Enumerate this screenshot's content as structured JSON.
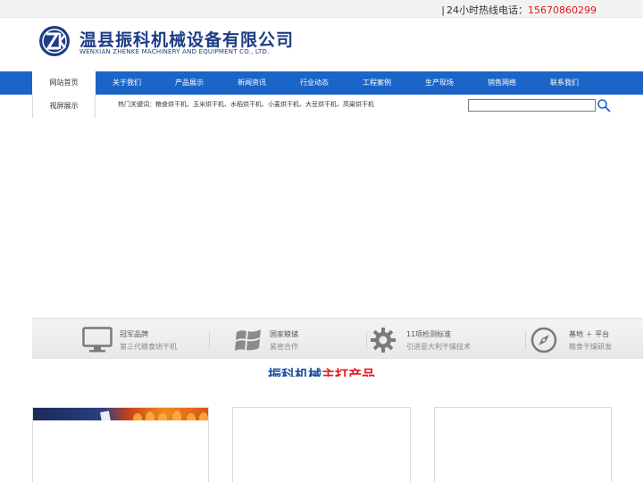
{
  "topbar": {
    "separator": "|",
    "hotline_label": "24小时热线电话：",
    "hotline_phone": "15670860299",
    "colors": {
      "phone": "#e0191f"
    }
  },
  "header": {
    "company_name": "温县振科机械设备有限公司",
    "company_name_en": "WENXIAN ZHENKE MACHINERY AND EQUIPMENT CO., LTD.",
    "logo_icon": "zk-logo-icon",
    "brand_color": "#1d3d86"
  },
  "nav": {
    "color": "#1b64c8",
    "items": [
      {
        "label": "网站首页",
        "active": true
      },
      {
        "label": "关于我们"
      },
      {
        "label": "产品展示"
      },
      {
        "label": "新闻资讯"
      },
      {
        "label": "行业动态"
      },
      {
        "label": "工程案例"
      },
      {
        "label": "生产现场"
      },
      {
        "label": "销售网络"
      },
      {
        "label": "联系我们"
      }
    ],
    "sub_item": "视屏展示"
  },
  "keywords": {
    "text": "热门关键词：粮食烘干机、玉米烘干机、水稻烘干机、小麦烘干机、大豆烘干机、高粱烘干机"
  },
  "search": {
    "value": "",
    "placeholder": "",
    "icon": "search-icon"
  },
  "features": [
    {
      "icon": "monitor-icon",
      "title": "冠军品牌",
      "subtitle": "第三代粮食烘干机"
    },
    {
      "icon": "windows-icon",
      "title": "国家粮储",
      "subtitle": "紧密合作"
    },
    {
      "icon": "gear-icon",
      "title": "11项检测标准",
      "subtitle": "引进意大利干燥技术"
    },
    {
      "icon": "compass-icon",
      "title": "基地 ＋ 平台",
      "subtitle": "粮食干燥研发"
    }
  ],
  "section": {
    "title_part1": "振科机械",
    "title_part2": "主打产品"
  }
}
